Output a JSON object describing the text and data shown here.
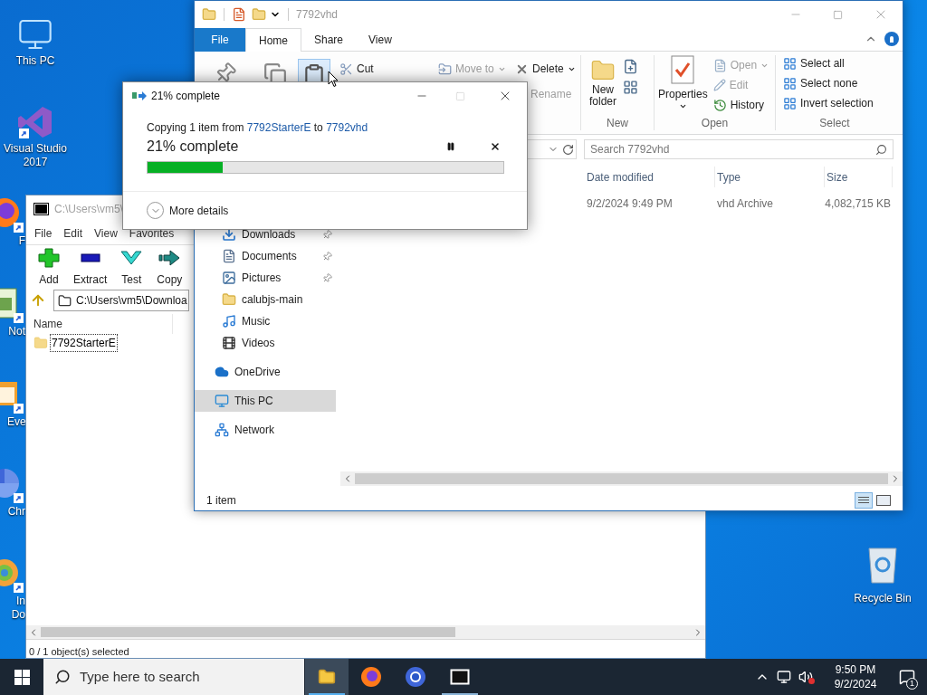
{
  "desktop": {
    "icons": [
      {
        "label": "This PC",
        "kind": "pc"
      },
      {
        "label": "Visual Studio 2017",
        "kind": "vs"
      }
    ],
    "covered_icons": [
      {
        "label": "F",
        "kind": "firefox"
      },
      {
        "label": "Not",
        "kind": "notepad"
      },
      {
        "label": "Eve",
        "kind": "event"
      },
      {
        "label": "Chr",
        "kind": "chrome"
      },
      {
        "label": "In Do",
        "kind": "ie"
      }
    ],
    "recycle_bin": {
      "label": "Recycle Bin"
    }
  },
  "archiver": {
    "title": "C:\\Users\\vm5\\",
    "menu": [
      "File",
      "Edit",
      "View",
      "Favorites"
    ],
    "toolbar": [
      {
        "label": "Add",
        "kind": "add"
      },
      {
        "label": "Extract",
        "kind": "extract"
      },
      {
        "label": "Test",
        "kind": "test"
      },
      {
        "label": "Copy",
        "kind": "copy"
      }
    ],
    "path": "C:\\Users\\vm5\\Downloa",
    "column": "Name",
    "items": [
      {
        "name": "7792StarterE",
        "selected": true
      }
    ],
    "status": "0 / 1 object(s) selected"
  },
  "explorer": {
    "title": "7792vhd",
    "tabs": [
      {
        "label": "File",
        "kind": "file",
        "selected": false
      },
      {
        "label": "Home",
        "kind": "tab",
        "selected": true
      },
      {
        "label": "Share",
        "kind": "tab",
        "selected": false
      },
      {
        "label": "View",
        "kind": "tab",
        "selected": false
      }
    ],
    "ribbon": {
      "cut": {
        "label": "Cut",
        "disabled": false
      },
      "organize": [
        {
          "label": "Move to",
          "disabled": true,
          "dropdown": true
        },
        {
          "label": "Delete",
          "disabled": false,
          "dropdown": true
        },
        {
          "label": "Rename",
          "disabled": true,
          "dropdown": false
        }
      ],
      "new": {
        "new_folder": "New folder",
        "group": "New"
      },
      "open": {
        "properties": "Properties",
        "group": "Open",
        "items": [
          {
            "label": "Open",
            "disabled": true,
            "dropdown": true
          },
          {
            "label": "Edit",
            "disabled": true,
            "dropdown": false
          },
          {
            "label": "History",
            "disabled": false,
            "dropdown": false
          }
        ]
      },
      "select": {
        "items": [
          "Select all",
          "Select none",
          "Invert selection"
        ],
        "group": "Select"
      }
    },
    "search": {
      "placeholder": "Search 7792vhd"
    },
    "columns": [
      "Date modified",
      "Type",
      "Size"
    ],
    "rows": [
      {
        "date": "9/2/2024 9:49 PM",
        "type": "vhd Archive",
        "size": "4,082,715 KB"
      }
    ],
    "quick_access": [
      {
        "label": "Downloads",
        "kind": "downloads",
        "pinned": true
      },
      {
        "label": "Documents",
        "kind": "documents",
        "pinned": true
      },
      {
        "label": "Pictures",
        "kind": "pictures",
        "pinned": true
      },
      {
        "label": "calubjs-main",
        "kind": "folder",
        "pinned": false
      },
      {
        "label": "Music",
        "kind": "music",
        "pinned": false
      },
      {
        "label": "Videos",
        "kind": "videos",
        "pinned": false
      }
    ],
    "roots": [
      {
        "label": "OneDrive",
        "kind": "cloud",
        "selected": false
      },
      {
        "label": "This PC",
        "kind": "pc",
        "selected": true
      },
      {
        "label": "Network",
        "kind": "network",
        "selected": false
      }
    ],
    "status": "1 item"
  },
  "copy_dialog": {
    "title": "21% complete",
    "prefix": "Copying 1 item from",
    "source": "7792StarterE",
    "joiner": "to",
    "dest": "7792vhd",
    "progress_label": "21% complete",
    "level": 0.21,
    "more": "More details"
  },
  "taskbar": {
    "search_placeholder": "Type here to search",
    "apps": [
      {
        "kind": "explorer",
        "active": true,
        "running": true
      },
      {
        "kind": "firefox",
        "active": false,
        "running": false
      },
      {
        "kind": "chrome",
        "active": false,
        "running": false
      },
      {
        "kind": "archiver",
        "active": false,
        "running": true
      }
    ],
    "time": "9:50 PM",
    "date": "9/2/2024",
    "notifications": "1"
  }
}
